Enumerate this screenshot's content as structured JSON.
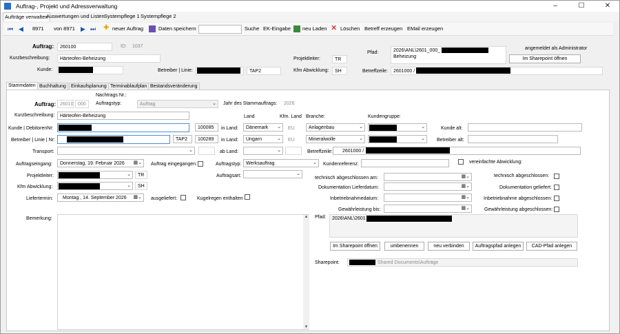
{
  "window": {
    "title": "Auftrag-, Projekt und Adressverwaltung",
    "minimize": "–",
    "maximize": "☐",
    "close": "✕"
  },
  "menu": [
    "Aufträge verwalten",
    "Auswertungen und Listen",
    "Systempflege 1",
    "Systempflege 2"
  ],
  "toolbar": {
    "record": "8971",
    "of": "von 8971",
    "new": "neuer Auftrag",
    "save": "Daten speichern",
    "search_value": "",
    "search": "Suche",
    "ek": "EK-Eingabe",
    "reload": "neu Laden",
    "delete": "Löschen",
    "betreff": "Betreff erzeugen",
    "email": "EMail erzeugen"
  },
  "header": {
    "auftrag_label": "Auftrag:",
    "auftrag": "260100",
    "id_label": "ID:",
    "id": "1037",
    "kurz_label": "Kurzbeschreibung:",
    "kurz": "Härteofen-Beheizung",
    "kunde_label": "Kunde:",
    "betreiber_label": "Betreiber | Linie:",
    "betreiber_linie": "TAP2",
    "pl_label": "Projektleiter:",
    "pl": "TR",
    "kfm_label": "Kfm Abwicklung:",
    "kfm": "SH",
    "pfad_label": "Pfad:",
    "pfad_line1": "2026\\ANL\\2601_000_",
    "pfad_line2": "Beheizung",
    "betreffzeile_label": "Betreffzeile:",
    "betreffzeile": "2601000 /",
    "logged": "angemeldet als Administrator",
    "sharepoint_btn": "Im Sharepoint öffnen"
  },
  "tabs": [
    "Stammdaten",
    "Buchhaltung",
    "Einkaufsplanung",
    "Terminablaufplan",
    "Bestandsveränderung"
  ],
  "stamm": {
    "nachtrag_label": "Nachtrags Nr.:",
    "auftrag_label": "Auftrag:",
    "auftrag": "26010",
    "nachtrag": "000",
    "auftragstyp_label": "Auftragstyp:",
    "auftragstyp": "Auftrag",
    "jahr_label": "Jahr des Stammauftrags:",
    "jahr": "2026",
    "kurz_label": "Kurzbeschreibung:",
    "kurz": "Härteofen-Beheizung",
    "land_header": "Land",
    "kfm_land_header": "Kfm. Land",
    "branche_header": "Branche:",
    "kundengruppe_header": "Kundengruppe:",
    "kunde_label": "Kunde | DebitorenNr:",
    "kunde_nr": "100085",
    "in_land": "in Land:",
    "kunde_land": "Dänemark",
    "kunde_kfm": "EU",
    "kunde_branche": "Anlagenbau",
    "kunde_alt_label": "Kunde alt:",
    "betreiber_label": "Betreiber | Linie | Nr:",
    "betreiber_linie": "TAP2",
    "betreiber_nr": "100289",
    "betreiber_land": "Ungarn",
    "betreiber_kfm": "EU",
    "betreiber_branche": "Mineralwolle",
    "betreiber_alt_label": "Betreiber alt:",
    "transport_label": "Transport:",
    "ab_land": "ab Land:",
    "betreffzeile_label": "Betreffzeile:",
    "betreffzeile": "2601000 /",
    "eingang_label": "Auftragseingang:",
    "eingang": "Donnerstag, 19.  Februar  2026",
    "eingegangen_label": "Auftrag eingegangen:",
    "typ_label": "Auftragstyp:",
    "typ": "Werksauftrag",
    "kundenref_label": "Kundenreferenz:",
    "vereinfacht_label": "vereinfachte Abwicklung:",
    "pl_label": "Projektleiter:",
    "pl": "TR",
    "art_label": "Auftragsart:",
    "tech_am_label": "technisch abgeschlossen am:",
    "tech_label": "technisch abgeschlossen:",
    "kfm_label": "Kfm Abwicklung:",
    "kfm": "SH",
    "doku_am_label": "Dokumentation Lieferdatum:",
    "doku_label": "Dokumentation geliefert:",
    "liefer_label": "Liefertermin:",
    "liefer": "Montag   , 14. September 2026",
    "ausgeliefert_label": "ausgeliefert:",
    "kugel_label": "Kugelregen enthalten",
    "inbetrieb_am_label": "Inbetriebnahmedatum:",
    "inbetrieb_label": "Inbetriebnahme abgeschlossen:",
    "gewahr_am_label": "Gewährleistung bis:",
    "gewahr_label": "Gewährleistung abgeschlossen:",
    "bemerkung_label": "Bemerkung:",
    "pfad_label": "Pfad:",
    "pfad": "2026\\ANL\\2601",
    "btn_sp": "Im Sharepoint öffnen",
    "btn_rename": "umbenennen",
    "btn_link": "neu verbinden",
    "btn_create": "Auftragspfad anlegen",
    "btn_cad": "CAD-Pfad anlegen",
    "sharepoint_label": "Sharepoint:",
    "sharepoint": "Shared Documents\\Aufträge"
  }
}
